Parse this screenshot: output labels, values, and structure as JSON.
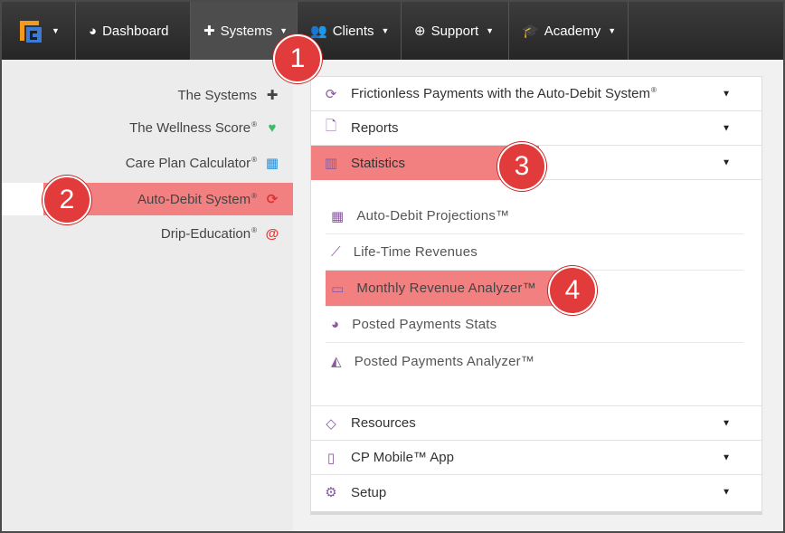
{
  "navbar": {
    "logo_icon": "app-logo-icon",
    "items": [
      {
        "label": "Dashboard",
        "icon": "dashboard-icon"
      },
      {
        "label": "Systems",
        "icon": "puzzle-icon"
      },
      {
        "label": "Clients",
        "icon": "users-icon"
      },
      {
        "label": "Support",
        "icon": "lifebuoy-icon"
      },
      {
        "label": "Academy",
        "icon": "graduation-cap-icon"
      }
    ]
  },
  "sidebar": {
    "items": [
      {
        "label": "The Systems",
        "reg": "",
        "icon": "puzzle-icon"
      },
      {
        "label": "The Wellness Score",
        "reg": "®",
        "icon": "heart-pulse-icon"
      },
      {
        "label": "Care Plan Calculator",
        "reg": "®",
        "icon": "calculator-icon"
      },
      {
        "label": "Auto-Debit System",
        "reg": "®",
        "icon": "refresh-icon"
      },
      {
        "label": "Drip-Education",
        "reg": "®",
        "icon": "at-icon"
      }
    ]
  },
  "panel": {
    "sections": [
      {
        "label": "Frictionless Payments with the Auto-Debit System",
        "reg": "®",
        "icon": "refresh-icon"
      },
      {
        "label": "Reports",
        "icon": "file-icon"
      },
      {
        "label": "Statistics",
        "icon": "bar-chart-icon"
      },
      {
        "label": "Resources",
        "icon": "diamond-icon"
      },
      {
        "label": "CP Mobile™ App",
        "icon": "mobile-icon"
      },
      {
        "label": "Setup",
        "icon": "gears-icon"
      }
    ],
    "statistics_items": [
      {
        "label": "Auto-Debit Projections™",
        "icon": "calendar-icon"
      },
      {
        "label": "Life-Time Revenues",
        "icon": "line-chart-icon"
      },
      {
        "label": "Monthly Revenue Analyzer™",
        "icon": "calendar-o-icon"
      },
      {
        "label": "Posted Payments Stats",
        "icon": "pie-chart-icon"
      },
      {
        "label": "Posted Payments Analyzer™",
        "icon": "area-chart-icon"
      }
    ]
  },
  "badges": [
    "1",
    "2",
    "3",
    "4"
  ],
  "colors": {
    "highlight": "#f28080",
    "badge": "#e23b3b",
    "navbar": "#2e2e2e",
    "icon_purple": "#8a5aa0"
  }
}
